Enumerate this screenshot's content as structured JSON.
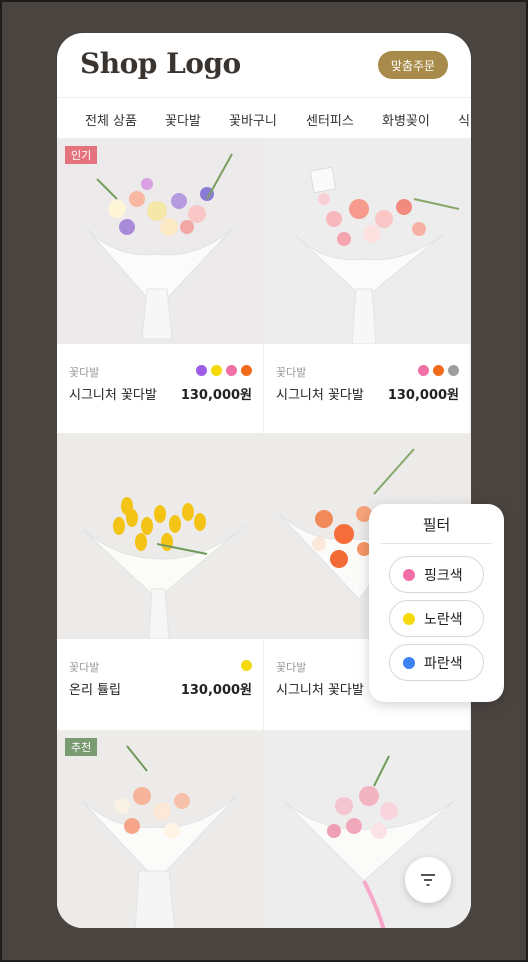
{
  "header": {
    "logo": "Shop Logo",
    "order_button": "맞춤주문"
  },
  "nav": {
    "items": [
      "전체 상품",
      "꽃다발",
      "꽃바구니",
      "센터피스",
      "화병꽂이",
      "식"
    ]
  },
  "products": [
    {
      "badge": "인기",
      "category": "꽃다발",
      "name": "시그니처 꽃다발",
      "price": "130,000원",
      "colors": [
        "#9b5de5",
        "#f5d90a",
        "#f06fa5",
        "#f26b1d"
      ],
      "photo": "mixed-bouquet"
    },
    {
      "badge": "",
      "category": "꽃다발",
      "name": "시그니처 꽃다발",
      "price": "130,000원",
      "colors": [
        "#f06fa5",
        "#f26b1d",
        "#9e9e9e"
      ],
      "photo": "pink-bouquet"
    },
    {
      "badge": "",
      "category": "꽃다발",
      "name": "온리 튤립",
      "price": "130,000원",
      "colors": [
        "#f5d90a"
      ],
      "photo": "yellow-tulips"
    },
    {
      "badge": "",
      "category": "꽃다발",
      "name": "시그니처 꽃다발",
      "price": "",
      "colors": [],
      "photo": "orange-bouquet"
    },
    {
      "badge": "추천",
      "category": "",
      "name": "",
      "price": "",
      "colors": [],
      "photo": "peach-bouquet"
    },
    {
      "badge": "",
      "category": "",
      "name": "",
      "price": "",
      "colors": [],
      "photo": "pink-rose-bouquet"
    }
  ],
  "filter": {
    "title": "필터",
    "options": [
      {
        "label": "핑크색",
        "color": "#f06fa5"
      },
      {
        "label": "노란색",
        "color": "#f5d90a"
      },
      {
        "label": "파란색",
        "color": "#3b82f6"
      }
    ]
  },
  "fab": {
    "icon": "filter-icon"
  }
}
